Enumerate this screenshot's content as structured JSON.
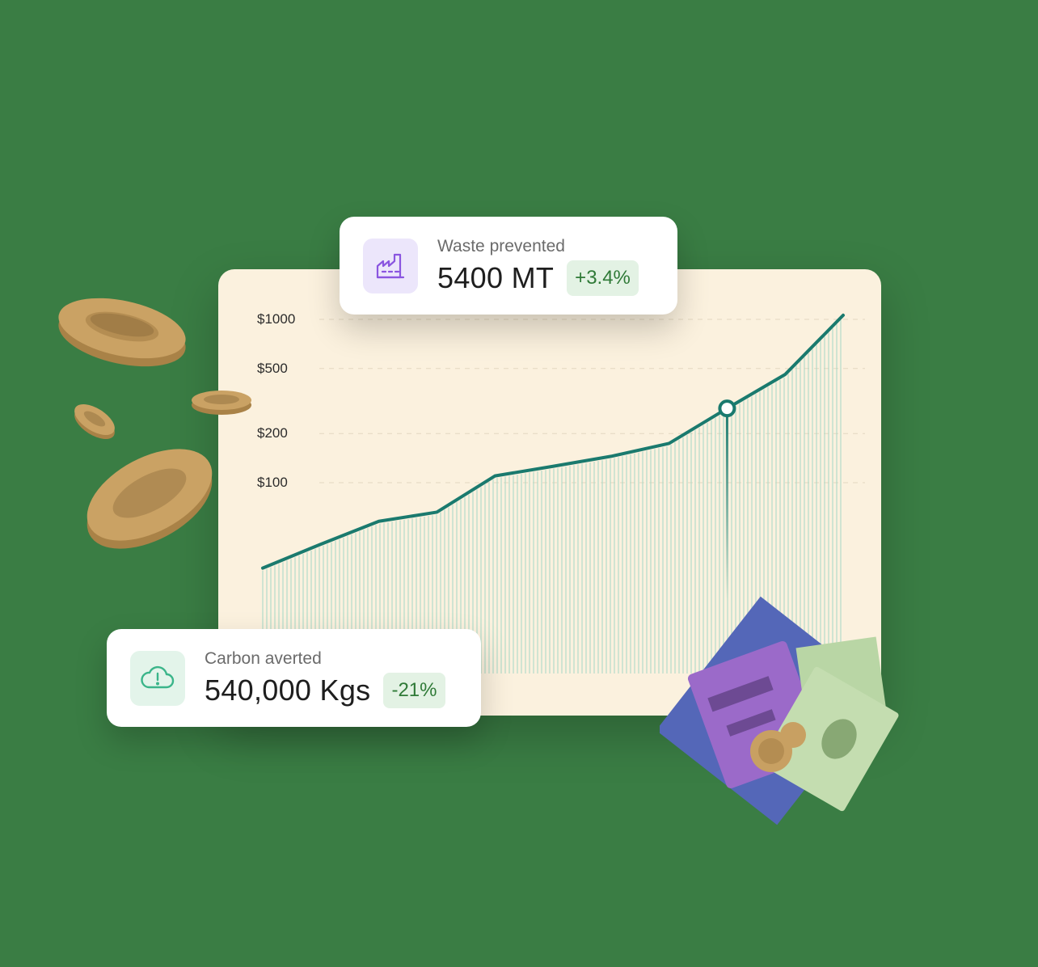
{
  "stats": {
    "waste": {
      "label": "Waste prevented",
      "value": "5400 MT",
      "change": "+3.4%",
      "icon": "factory-icon"
    },
    "carbon": {
      "label": "Carbon averted",
      "value": "540,000 Kgs",
      "change": "-21%",
      "icon": "cloud-alert-icon"
    }
  },
  "colors": {
    "background": "#3a7d44",
    "panel": "#fbf1de",
    "line": "#1a7a6e",
    "badge_bg": "#e3f2e4",
    "badge_text": "#2f7a37",
    "waste_icon": "#8a55e0",
    "carbon_icon": "#3bb58a"
  },
  "chart_data": {
    "type": "area",
    "y_ticks": [
      "$1000",
      "$500",
      "$200",
      "$100"
    ],
    "y_tick_values": [
      1000,
      500,
      200,
      100
    ],
    "y_scale": "log",
    "grid": true,
    "x": [
      0,
      1,
      2,
      3,
      4,
      5,
      6,
      7,
      8,
      9,
      10
    ],
    "y": [
      30,
      42,
      58,
      66,
      110,
      126,
      145,
      174,
      285,
      460,
      1060
    ],
    "highlight_index": 8
  }
}
